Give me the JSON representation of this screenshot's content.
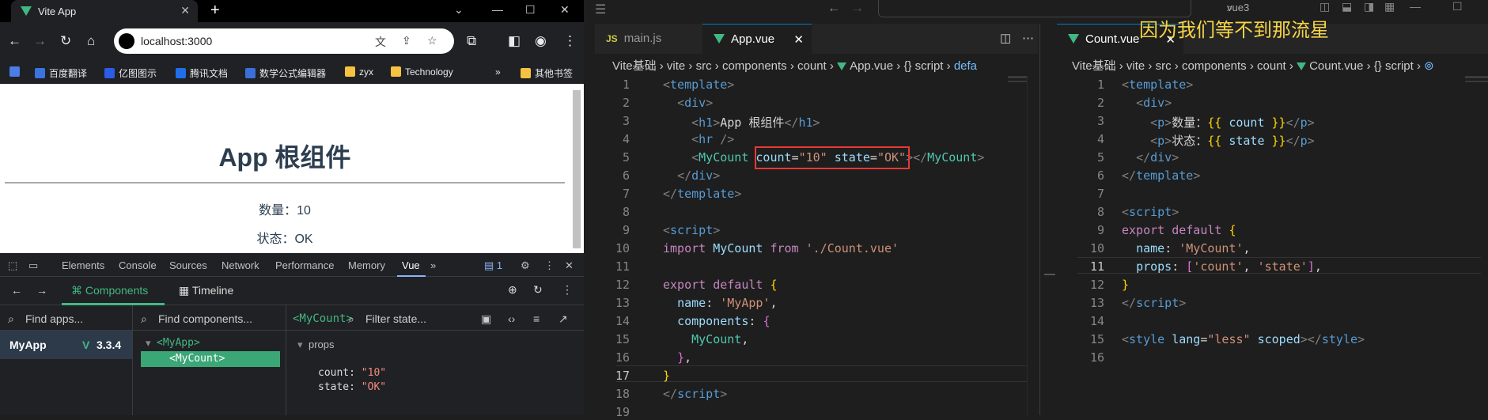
{
  "browser": {
    "tab_title": "Vite App",
    "new_tab": "+",
    "url": "localhost:3000",
    "bookmarks": [
      {
        "label": "百度翻译",
        "color": "#3b73e0"
      },
      {
        "label": "亿图图示",
        "color": "#2b5ce6"
      },
      {
        "label": "腾讯文档",
        "color": "#1f6feb"
      },
      {
        "label": "数学公式编辑器",
        "color": "#3a6fd8"
      },
      {
        "label": "zyx",
        "color": "#f5c242"
      },
      {
        "label": "Technology",
        "color": "#f5c242"
      },
      {
        "label": "其他书签",
        "color": "#f5c242"
      }
    ],
    "more": "»",
    "page": {
      "heading": "App 根组件",
      "count_line": "数量：10",
      "state_line": "状态：OK"
    }
  },
  "devtools": {
    "tabs": [
      "Elements",
      "Console",
      "Sources",
      "Network",
      "Performance",
      "Memory",
      "Vue"
    ],
    "active_tab": "Vue",
    "badge": "1",
    "components_tab": "Components",
    "timeline_tab": "Timeline",
    "find_apps_placeholder": "Find apps...",
    "find_components_placeholder": "Find components...",
    "selected_component": "<MyCount>",
    "filter_state_placeholder": "Filter state...",
    "app_name": "MyApp",
    "vue_version": "3.3.4",
    "tree": {
      "root": "<MyApp>",
      "child": "<MyCount>"
    },
    "props_label": "props",
    "props": [
      {
        "key": "count",
        "value": "\"10\""
      },
      {
        "key": "state",
        "value": "\"OK\""
      }
    ]
  },
  "editor": {
    "command_center": "vue3",
    "overlay_caption": "因为我们等不到那流星",
    "left_pane": {
      "tabs": [
        {
          "icon": "JS",
          "label": "main.js"
        },
        {
          "label": "App.vue",
          "close": "✕"
        }
      ],
      "breadcrumb": [
        "Vite基础",
        "vite",
        "src",
        "components",
        "count",
        "App.vue",
        "{} script",
        "defa"
      ],
      "line_numbers": [
        "1",
        "2",
        "3",
        "4",
        "5",
        "6",
        "7",
        "8",
        "9",
        "10",
        "11",
        "12",
        "13",
        "14",
        "15",
        "16",
        "17",
        "18",
        "19"
      ],
      "current_line": "17"
    },
    "right_pane": {
      "tabs": [
        {
          "label": "Count.vue",
          "close": "✕"
        }
      ],
      "breadcrumb": [
        "Vite基础",
        "vite",
        "src",
        "components",
        "count",
        "Count.vue",
        "{} script"
      ],
      "line_numbers": [
        "1",
        "2",
        "3",
        "4",
        "5",
        "6",
        "7",
        "8",
        "9",
        "10",
        "11",
        "12",
        "13",
        "14",
        "15",
        "16"
      ],
      "current_line": "11"
    }
  }
}
